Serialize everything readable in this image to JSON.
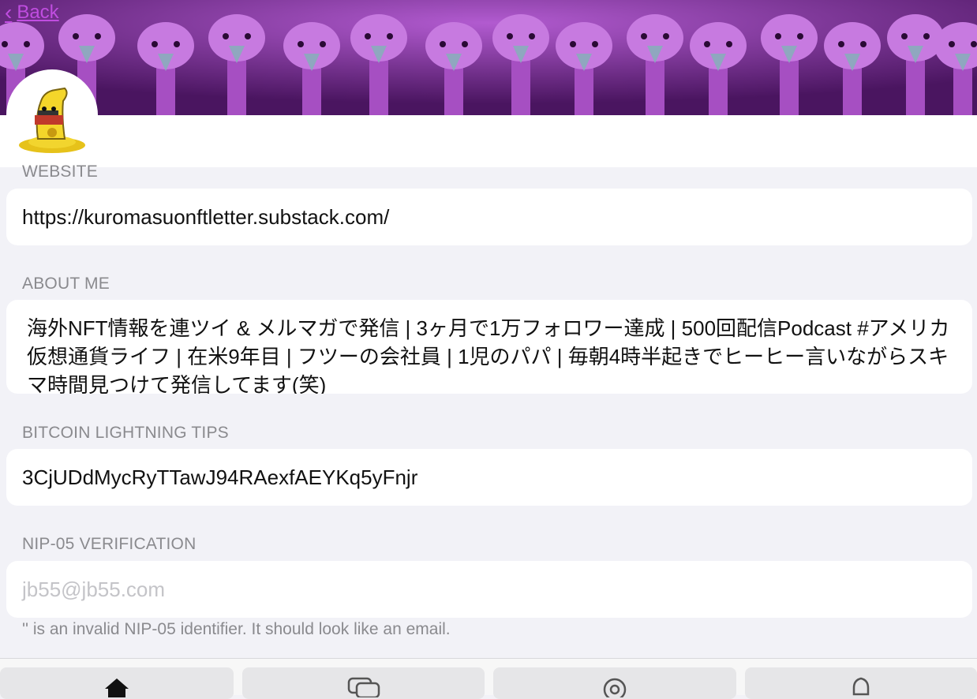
{
  "header": {
    "back_label": "Back"
  },
  "sections": {
    "website": {
      "label": "WEBSITE",
      "value": "https://kuromasuonftletter.substack.com/"
    },
    "about": {
      "label": "ABOUT ME",
      "value": "海外NFT情報を連ツイ & メルマガで発信 | 3ヶ月で1万フォロワー達成 | 500回配信Podcast #アメリカ仮想通貨ライフ | 在米9年目 | フツーの会社員 | 1児のパパ | 毎朝4時半起きでヒーヒー言いながらスキマ時間見つけて発信してます(笑)"
    },
    "lightning": {
      "label": "BITCOIN LIGHTNING TIPS",
      "value": "3CjUDdMycRyTTawJ94RAexfAEYKq5yFnjr"
    },
    "nip05": {
      "label": "NIP-05 VERIFICATION",
      "placeholder": "jb55@jb55.com",
      "hint": "'' is an invalid NIP-05 identifier. It should look like an email."
    }
  },
  "tabs": [
    {
      "icon": "home-icon"
    },
    {
      "icon": "messages-icon"
    },
    {
      "icon": "search-icon"
    },
    {
      "icon": "bell-icon"
    }
  ],
  "colors": {
    "accent": "#c04de0",
    "banner": "#7a3199",
    "background": "#f2f2f7",
    "label": "#8a8a8e",
    "placeholder": "#c4c4c8"
  }
}
